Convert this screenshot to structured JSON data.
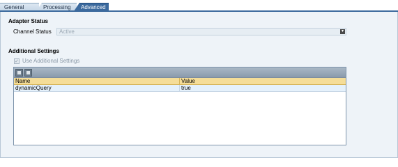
{
  "tabs": [
    {
      "label": "General"
    },
    {
      "label": "Processing"
    },
    {
      "label": "Advanced"
    }
  ],
  "adapter_status": {
    "title": "Adapter Status",
    "channel_status_label": "Channel Status",
    "channel_status_value": "Active"
  },
  "additional_settings": {
    "title": "Additional Settings",
    "use_checkbox_label": "Use Additional Settings",
    "use_checked": true,
    "table": {
      "columns": [
        "Name",
        "Value"
      ],
      "rows": [
        {
          "name": "dynamicQuery",
          "value": "true"
        }
      ]
    }
  },
  "colors": {
    "active_tab": "#3c6a9e",
    "header_row": "#f5dd98",
    "panel_bg": "#eef3f8"
  }
}
